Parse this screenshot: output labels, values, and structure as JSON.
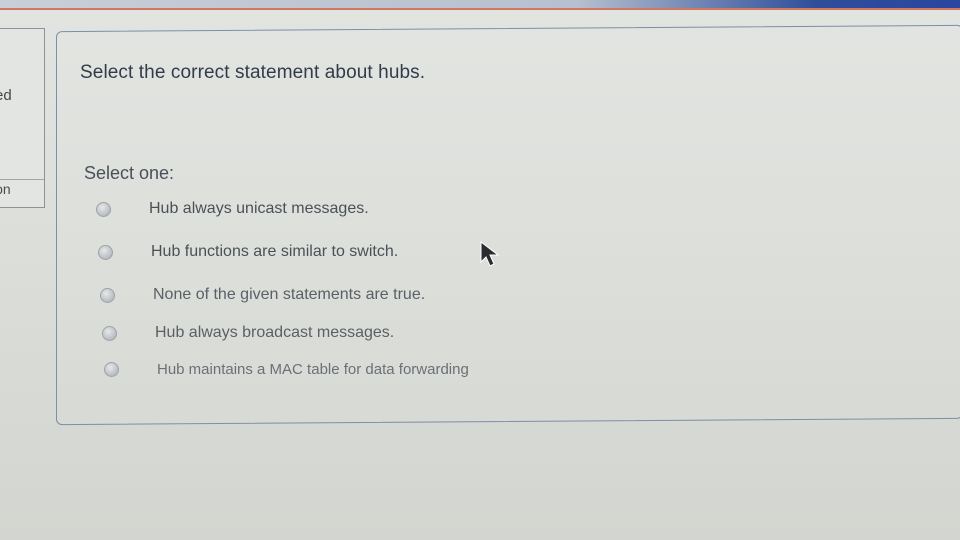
{
  "sidebar": {
    "state_text": "red",
    "flag_text": "ion"
  },
  "question": {
    "text": "Select the correct statement about hubs.",
    "prompt": "Select one:",
    "options": [
      {
        "label": "Hub always unicast messages."
      },
      {
        "label": "Hub functions are similar to switch."
      },
      {
        "label": "None of the given statements are true."
      },
      {
        "label": "Hub always broadcast messages."
      },
      {
        "label": "Hub maintains a MAC table for data forwarding"
      }
    ]
  },
  "colors": {
    "top_bar": "#2a46a0",
    "box_border": "#7d8ea6"
  },
  "icons": {
    "cursor": "mouse-pointer-icon",
    "radio": "radio-button-icon"
  }
}
